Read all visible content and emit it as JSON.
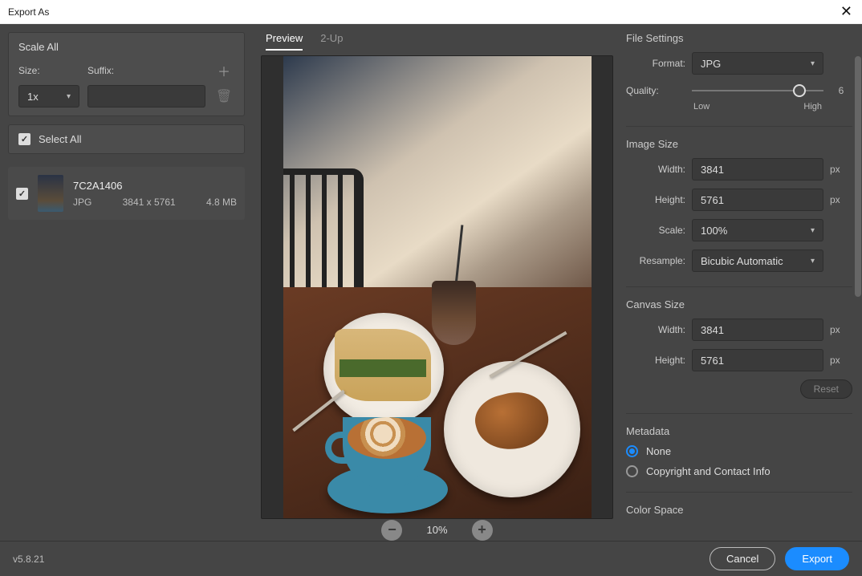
{
  "window": {
    "title": "Export As",
    "close": "✕"
  },
  "scale": {
    "title": "Scale All",
    "size_label": "Size:",
    "suffix_label": "Suffix:",
    "size_value": "1x",
    "suffix_value": "",
    "add_icon": "＋",
    "trash_icon": "🗑"
  },
  "selectall": {
    "label": "Select All",
    "checked": true
  },
  "files": [
    {
      "name": "7C2A1406",
      "format": "JPG",
      "dims": "3841 x 5761",
      "size": "4.8 MB",
      "checked": true
    }
  ],
  "tabs": {
    "preview": "Preview",
    "twoup": "2-Up",
    "active": "preview"
  },
  "zoom": {
    "out": "−",
    "in": "+",
    "value": "10%"
  },
  "fileSettings": {
    "title": "File Settings",
    "format_label": "Format:",
    "format_value": "JPG",
    "quality_label": "Quality:",
    "quality_value": "6",
    "quality_low": "Low",
    "quality_high": "High",
    "quality_pct": 82
  },
  "imageSize": {
    "title": "Image Size",
    "width_label": "Width:",
    "width_value": "3841",
    "height_label": "Height:",
    "height_value": "5761",
    "scale_label": "Scale:",
    "scale_value": "100%",
    "resample_label": "Resample:",
    "resample_value": "Bicubic Automatic",
    "px": "px"
  },
  "canvasSize": {
    "title": "Canvas Size",
    "width_label": "Width:",
    "width_value": "3841",
    "height_label": "Height:",
    "height_value": "5761",
    "px": "px",
    "reset": "Reset"
  },
  "metadata": {
    "title": "Metadata",
    "none": "None",
    "copyright": "Copyright and Contact Info",
    "selected": "none"
  },
  "colorspace": {
    "title": "Color Space"
  },
  "footer": {
    "version": "v5.8.21",
    "cancel": "Cancel",
    "export": "Export"
  }
}
